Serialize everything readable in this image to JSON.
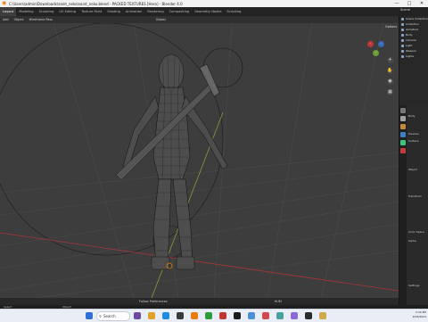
{
  "titlebar": {
    "title": "C:\\Users\\admin\\Downloads\\saint_neko\\saint_neko.blend - PACKED TEXTURES [Hero] - Blender 4.0"
  },
  "menubar": {
    "tabs": [
      "Layout",
      "Modeling",
      "Sculpting",
      "UV Editing",
      "Texture Paint",
      "Shading",
      "Animation",
      "Rendering",
      "Compositing",
      "Geometry Nodes",
      "Scripting"
    ],
    "scene_label": "Scene"
  },
  "viewport_header": {
    "items": [
      "Add",
      "Object",
      "Wireframe Pass",
      "Global",
      "Options"
    ]
  },
  "viewport": {
    "footer_left": "Follow Preferences",
    "footer_mid": "HUM"
  },
  "outliner": {
    "items": [
      "Scene Collection",
      "Collection",
      "Armature",
      "Body",
      "Camera",
      "Light",
      "Weapon",
      "Lights"
    ]
  },
  "properties": {
    "rows": [
      "Body",
      "Preview",
      "Surface",
      "Object",
      "Transform",
      "Color Space",
      "Alpha",
      "Settings"
    ]
  },
  "statusbar": {
    "left": "Select",
    "right": "Object"
  },
  "taskbar": {
    "search_placeholder": "Search",
    "time": "3:30 PM",
    "date": "9/18/2024"
  },
  "colors": {
    "blender_orange": "#e87d0d",
    "grid_red": "#a83838",
    "grid_green": "#8c9a3a"
  }
}
